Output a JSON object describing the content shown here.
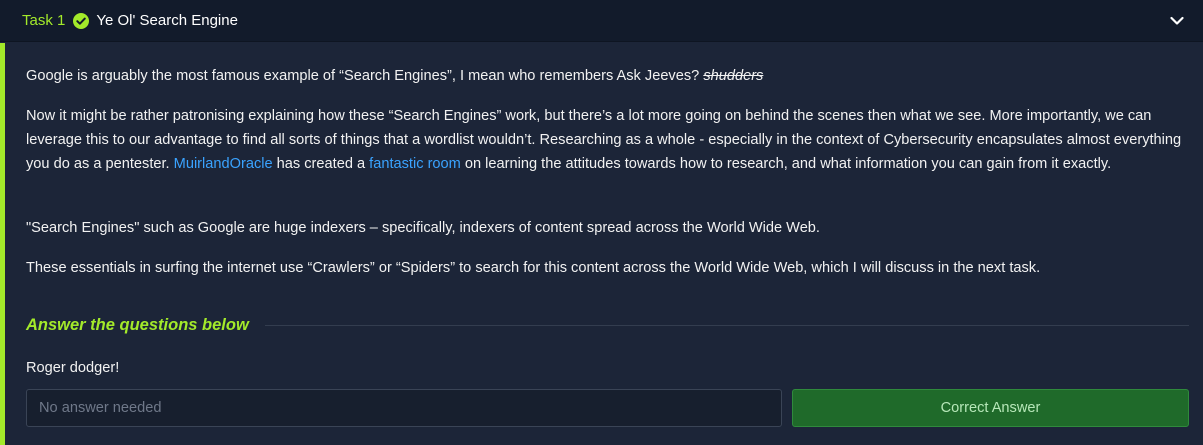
{
  "header": {
    "task_number": "Task 1",
    "title": "Ye Ol' Search Engine",
    "check_color": "#a3ea2a",
    "check_icon": "check-circle-icon",
    "expand_icon": "chevron-down-icon"
  },
  "body": {
    "p1": {
      "text": "Google is arguably the most famous example of “Search Engines”, I mean who remembers Ask Jeeves? ",
      "strike": "shudders"
    },
    "p2": {
      "part1": "Now it might be rather patronising explaining how these “Search Engines” work, but there’s a lot more going on behind the scenes then what we see. More importantly, we can leverage this to our advantage to find all sorts of things that a wordlist wouldn’t. Researching as a whole - especially in the context of Cybersecurity encapsulates almost everything you do as a pentester. ",
      "link1": "MuirlandOracle",
      "part2": " has created a ",
      "link2": "fantastic room",
      "part3": " on learning the attitudes towards how to research, and what information you can gain from it exactly."
    },
    "p3": "\"Search Engines\" such as Google are huge indexers – specifically, indexers of content spread across the World Wide Web.",
    "p4": "These essentials in surfing the internet use “Crawlers” or “Spiders” to search for this content across the World Wide Web, which I will discuss in the next task."
  },
  "answers": {
    "heading": "Answer the questions below",
    "question": "Roger dodger!",
    "input_placeholder": "No answer needed",
    "button_label": "Correct Answer"
  },
  "colors": {
    "accent": "#a3ea2a",
    "link": "#3aa3ff",
    "success": "#1f6a2a"
  }
}
